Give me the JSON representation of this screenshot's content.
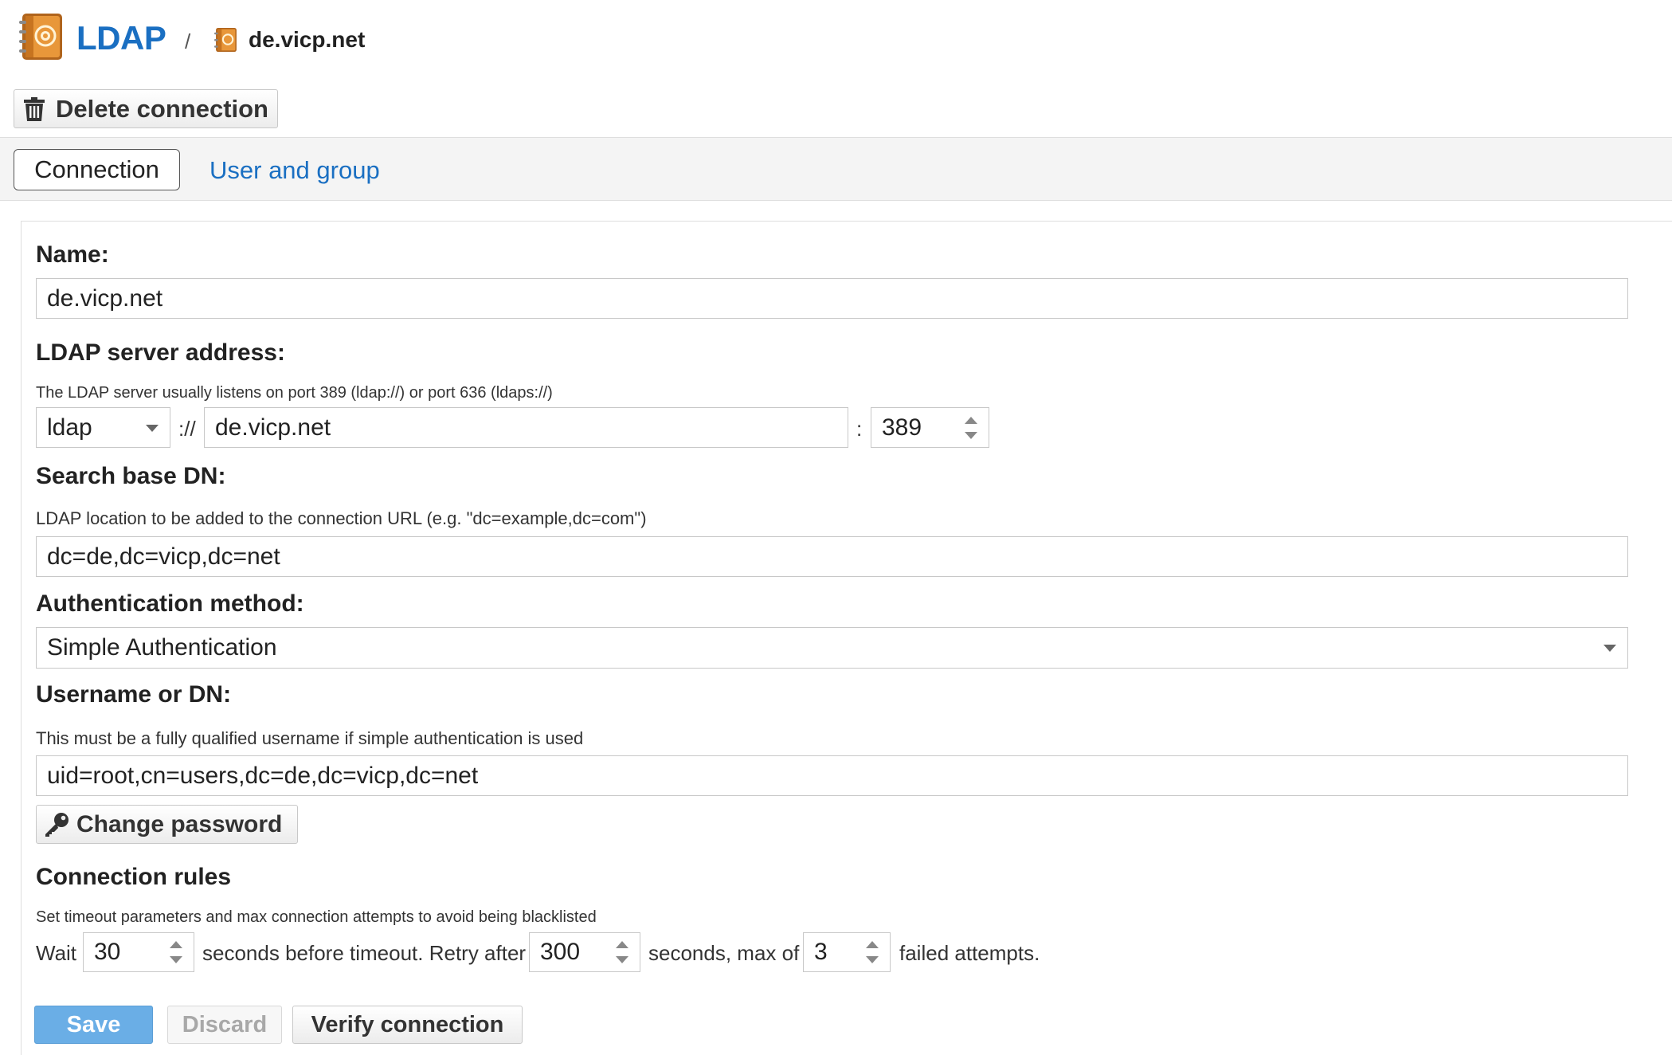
{
  "header": {
    "app_title": "LDAP",
    "separator": "/",
    "current": "de.vicp.net",
    "app_icon": "address-book-icon"
  },
  "toolbar": {
    "delete_label": "Delete connection",
    "delete_icon": "trash-icon"
  },
  "tabs": [
    {
      "label": "Connection",
      "active": true
    },
    {
      "label": "User and group",
      "active": false
    }
  ],
  "form": {
    "name": {
      "label": "Name:",
      "value": "de.vicp.net"
    },
    "server": {
      "label": "LDAP server address:",
      "hint": "The LDAP server usually listens on port 389 (ldap://) or port 636 (ldaps://)",
      "protocol": "ldap",
      "scheme_sep": "://",
      "host": "de.vicp.net",
      "port_sep": ":",
      "port": "389"
    },
    "base_dn": {
      "label": "Search base DN:",
      "hint": "LDAP location to be added to the connection URL (e.g. \"dc=example,dc=com\")",
      "value": "dc=de,dc=vicp,dc=net"
    },
    "auth": {
      "label": "Authentication method:",
      "value": "Simple Authentication"
    },
    "username": {
      "label": "Username or DN:",
      "hint": "This must be a fully qualified username if simple authentication is used",
      "value": "uid=root,cn=users,dc=de,dc=vicp,dc=net"
    },
    "change_password_label": "Change password",
    "change_password_icon": "key-icon",
    "rules": {
      "label": "Connection rules",
      "hint": "Set timeout parameters and max connection attempts to avoid being blacklisted",
      "wait_label": "Wait",
      "timeout": "30",
      "mid1": "seconds before timeout. Retry after",
      "retry": "300",
      "mid2": "seconds, max of",
      "max": "3",
      "end": "failed attempts."
    }
  },
  "actions": {
    "save": "Save",
    "discard": "Discard",
    "verify": "Verify connection"
  },
  "colors": {
    "accent": "#1a6fc2",
    "save_button": "#6aaee6"
  }
}
